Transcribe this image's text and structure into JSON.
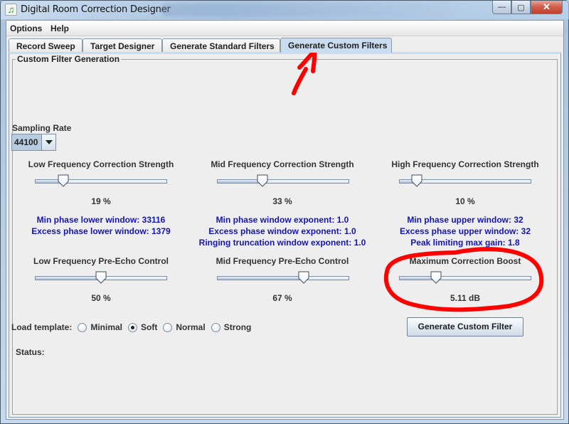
{
  "window": {
    "title": "Digital Room Correction Designer",
    "controls": {
      "minimize": "—",
      "maximize": "▢",
      "close": "✕"
    }
  },
  "menu": {
    "items": [
      "Options",
      "Help"
    ]
  },
  "tabs": [
    {
      "label": "Record Sweep",
      "active": false
    },
    {
      "label": "Target Designer",
      "active": false
    },
    {
      "label": "Generate Standard Filters",
      "active": false
    },
    {
      "label": "Generate Custom Filters",
      "active": true
    }
  ],
  "panel": {
    "group_title": "Custom Filter Generation",
    "sampling_rate": {
      "label": "Sampling Rate",
      "value": "44100"
    },
    "sliders": {
      "low_freq_strength": {
        "label": "Low Frequency Correction Strength",
        "value_text": "19 %",
        "fraction": 0.19
      },
      "mid_freq_strength": {
        "label": "Mid Frequency Correction Strength",
        "value_text": "33 %",
        "fraction": 0.33
      },
      "high_freq_strength": {
        "label": "High Frequency Correction Strength",
        "value_text": "10 %",
        "fraction": 0.1
      },
      "low_freq_preecho": {
        "label": "Low Frequency Pre-Echo Control",
        "value_text": "50 %",
        "fraction": 0.5
      },
      "mid_freq_preecho": {
        "label": "Mid Frequency Pre-Echo Control",
        "value_text": "67 %",
        "fraction": 0.67
      },
      "max_boost": {
        "label": "Maximum Correction Boost",
        "value_text": "5.11 dB",
        "fraction": 0.26
      }
    },
    "info": {
      "low": [
        "Min phase lower window: 33116",
        "Excess phase lower window: 1379"
      ],
      "mid": [
        "Min phase window exponent: 1.0",
        "Excess phase window exponent: 1.0",
        "Ringing truncation window exponent: 1.0"
      ],
      "high": [
        "Min phase upper window: 32",
        "Excess phase upper window: 32",
        "Peak limiting max gain: 1.8"
      ]
    },
    "template": {
      "label": "Load template:",
      "options": [
        {
          "label": "Minimal",
          "checked": false
        },
        {
          "label": "Soft",
          "checked": true
        },
        {
          "label": "Normal",
          "checked": false
        },
        {
          "label": "Strong",
          "checked": false
        }
      ]
    },
    "generate_button": "Generate Custom Filter",
    "status_label": "Status:",
    "status_value": ""
  },
  "colors": {
    "info_text": "#1414b4",
    "annotation": "#ff0000",
    "active_tab": "#c9dcf0"
  }
}
